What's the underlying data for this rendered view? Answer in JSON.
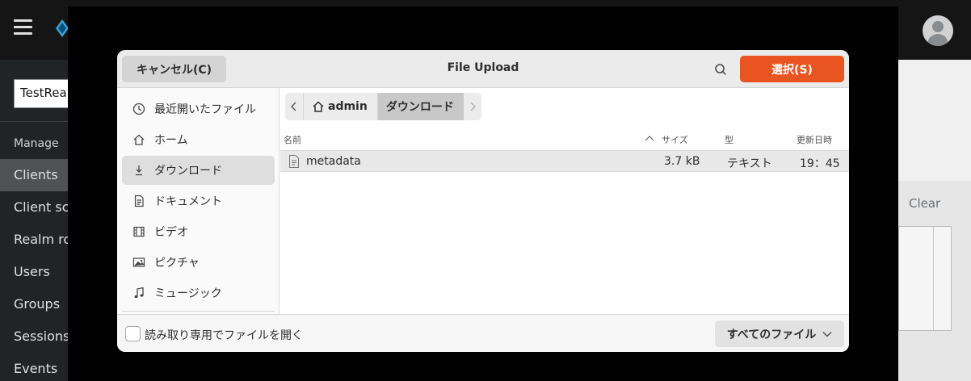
{
  "app": {
    "realm_value": "TestRealm",
    "section_label": "Manage",
    "nav": [
      {
        "label": "Clients",
        "active": true
      },
      {
        "label": "Client scopes",
        "active": false
      },
      {
        "label": "Realm roles",
        "active": false
      },
      {
        "label": "Users",
        "active": false
      },
      {
        "label": "Groups",
        "active": false
      },
      {
        "label": "Sessions",
        "active": false
      },
      {
        "label": "Events",
        "active": false
      }
    ],
    "clear_label": "Clear"
  },
  "dialog": {
    "title": "File Upload",
    "cancel_label": "キャンセル(C)",
    "select_label": "選択(S)",
    "accent_color": "#e95420",
    "places": [
      {
        "label": "最近開いたファイル",
        "icon": "clock-icon"
      },
      {
        "label": "ホーム",
        "icon": "home-icon"
      },
      {
        "label": "ダウンロード",
        "icon": "download-icon",
        "selected": true
      },
      {
        "label": "ドキュメント",
        "icon": "document-icon"
      },
      {
        "label": "ビデオ",
        "icon": "film-icon"
      },
      {
        "label": "ピクチャ",
        "icon": "picture-icon"
      },
      {
        "label": "ミュージック",
        "icon": "music-icon"
      }
    ],
    "path": [
      {
        "label": "admin",
        "icon": "home-icon"
      },
      {
        "label": "ダウンロード",
        "current": true
      }
    ],
    "columns": {
      "name": "名前",
      "size": "サイズ",
      "type": "型",
      "modified": "更新日時"
    },
    "files": [
      {
        "name": "metadata",
        "size": "3.7 kB",
        "type": "テキスト",
        "modified": "19：45"
      }
    ],
    "readonly_label": "読み取り専用でファイルを開く",
    "filter_label": "すべてのファイル"
  }
}
